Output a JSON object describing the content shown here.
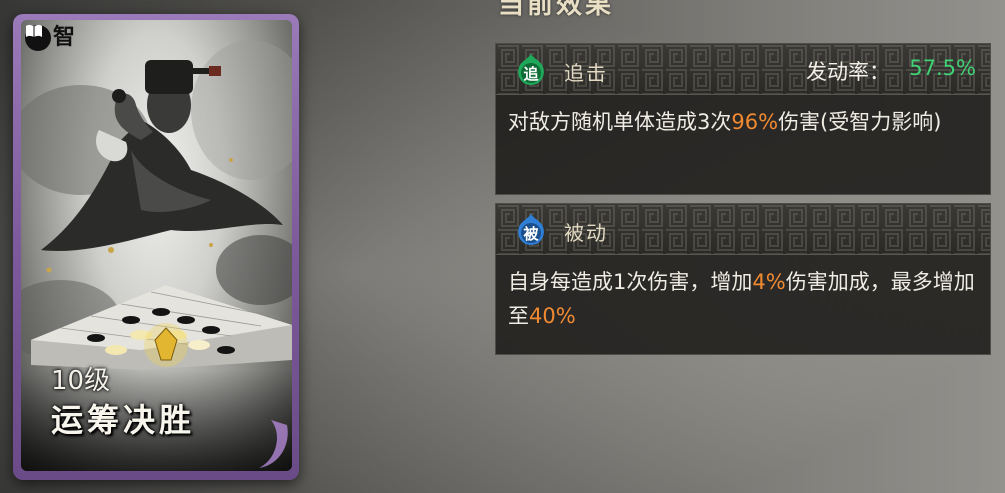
{
  "card": {
    "type_label": "智",
    "level": "10级",
    "name": "运筹决胜"
  },
  "panel": {
    "section_title": "当前效果",
    "effects": [
      {
        "icon_char": "追",
        "icon_color": "#1fa85a",
        "type": "追击",
        "rate_label": "发动率：",
        "rate_value": "57.5%",
        "desc_parts": [
          "对敌方随机单体造成3次",
          "96%",
          "伤害(受智力影响)"
        ]
      },
      {
        "icon_char": "被",
        "icon_color": "#2f7fd6",
        "type": "被动",
        "desc_parts": [
          "自身每造成1次伤害，增加",
          "4%",
          "伤害加成，最多增加至",
          "40%"
        ]
      }
    ]
  },
  "colors": {
    "highlight": "#f08a32",
    "rate": "#3fd174",
    "card_frame": "#7d5a9c"
  }
}
